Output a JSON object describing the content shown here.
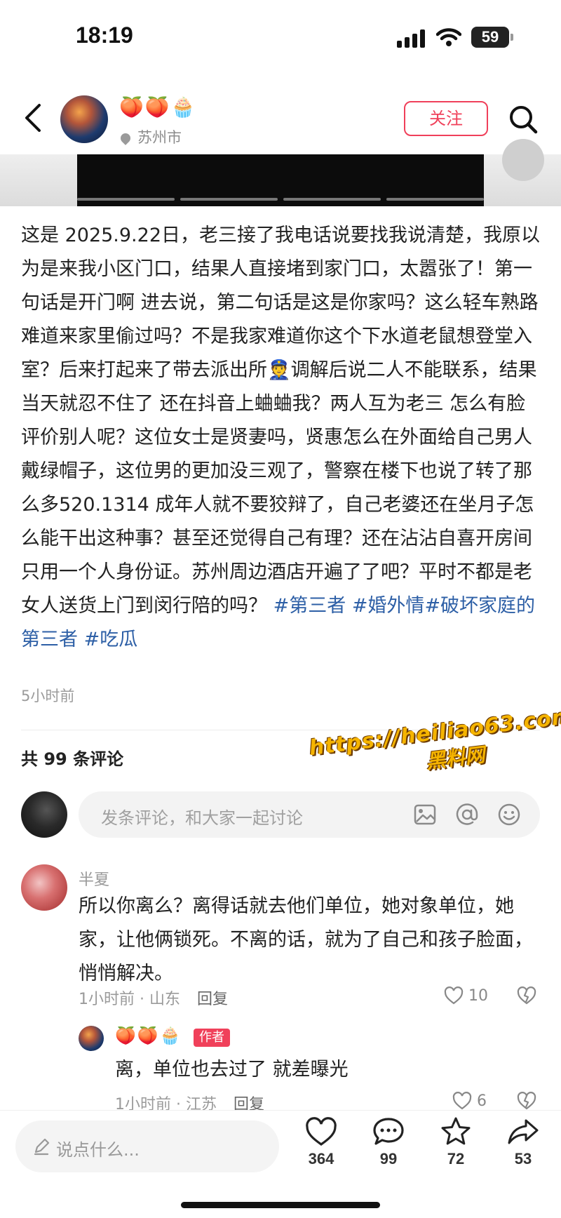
{
  "status_bar": {
    "time": "18:19",
    "battery": "59"
  },
  "header": {
    "author_name": "🍑🍑🧁",
    "location": "苏州市",
    "follow_label": "关注",
    "icons": [
      "back-icon",
      "search-icon",
      "location-pin-icon"
    ]
  },
  "post": {
    "body": "这是 2025.9.22日，老三接了我电话说要找我说清楚，我原以为是来我小区门口，结果人直接堵到家门口，太嚣张了！第一句话是开门啊 进去说，第二句话是这是你家吗？这么轻车熟路难道来家里偷过吗？不是我家难道你这个下水道老鼠想登堂入室？后来打起来了带去派出所👮调解后说二人不能联系，结果当天就忍不住了 还在抖音上蛐蛐我？两人互为老三 怎么有脸评价别人呢？这位女士是贤妻吗，贤惠怎么在外面给自己男人戴绿帽子，这位男的更加没三观了，警察在楼下也说了转了那么多520.1314 成年人就不要狡辩了，自己老婆还在坐月子怎么能干出这种事？甚至还觉得自己有理？还在沾沾自喜开房间只用一个人身份证。苏州周边酒店开遍了了吧？平时不都是老女人送货上门到闵行陪的吗？",
    "hashtags": [
      "#第三者",
      "#婚外情",
      "#破坏家庭的第三者",
      "#吃瓜"
    ],
    "time": "5小时前"
  },
  "watermark": {
    "line1": "https://heiliao63.com",
    "line2": "黑料网"
  },
  "comments_section": {
    "count_label": "共 99 条评论",
    "input_placeholder": "发条评论，和大家一起讨论",
    "input_icons": [
      "image-icon",
      "at-icon",
      "emoji-icon"
    ]
  },
  "comments": [
    {
      "name": "半夏",
      "text": "所以你离么？离得话就去他们单位，她对象单位，她家，让他俩锁死。不离的话，就为了自己和孩子脸面，悄悄解决。",
      "meta": "1小时前 · 山东",
      "reply_label": "回复",
      "likes": "10",
      "reply": {
        "name": "🍑🍑🧁",
        "badge": "作者",
        "text": "离，单位也去过了 就差曝光",
        "meta": "1小时前 · 江苏",
        "reply_label": "回复",
        "likes": "6"
      }
    }
  ],
  "bottom_bar": {
    "input_placeholder": "说点什么...",
    "likes": "364",
    "comments": "99",
    "favorites": "72",
    "shares": "53"
  }
}
